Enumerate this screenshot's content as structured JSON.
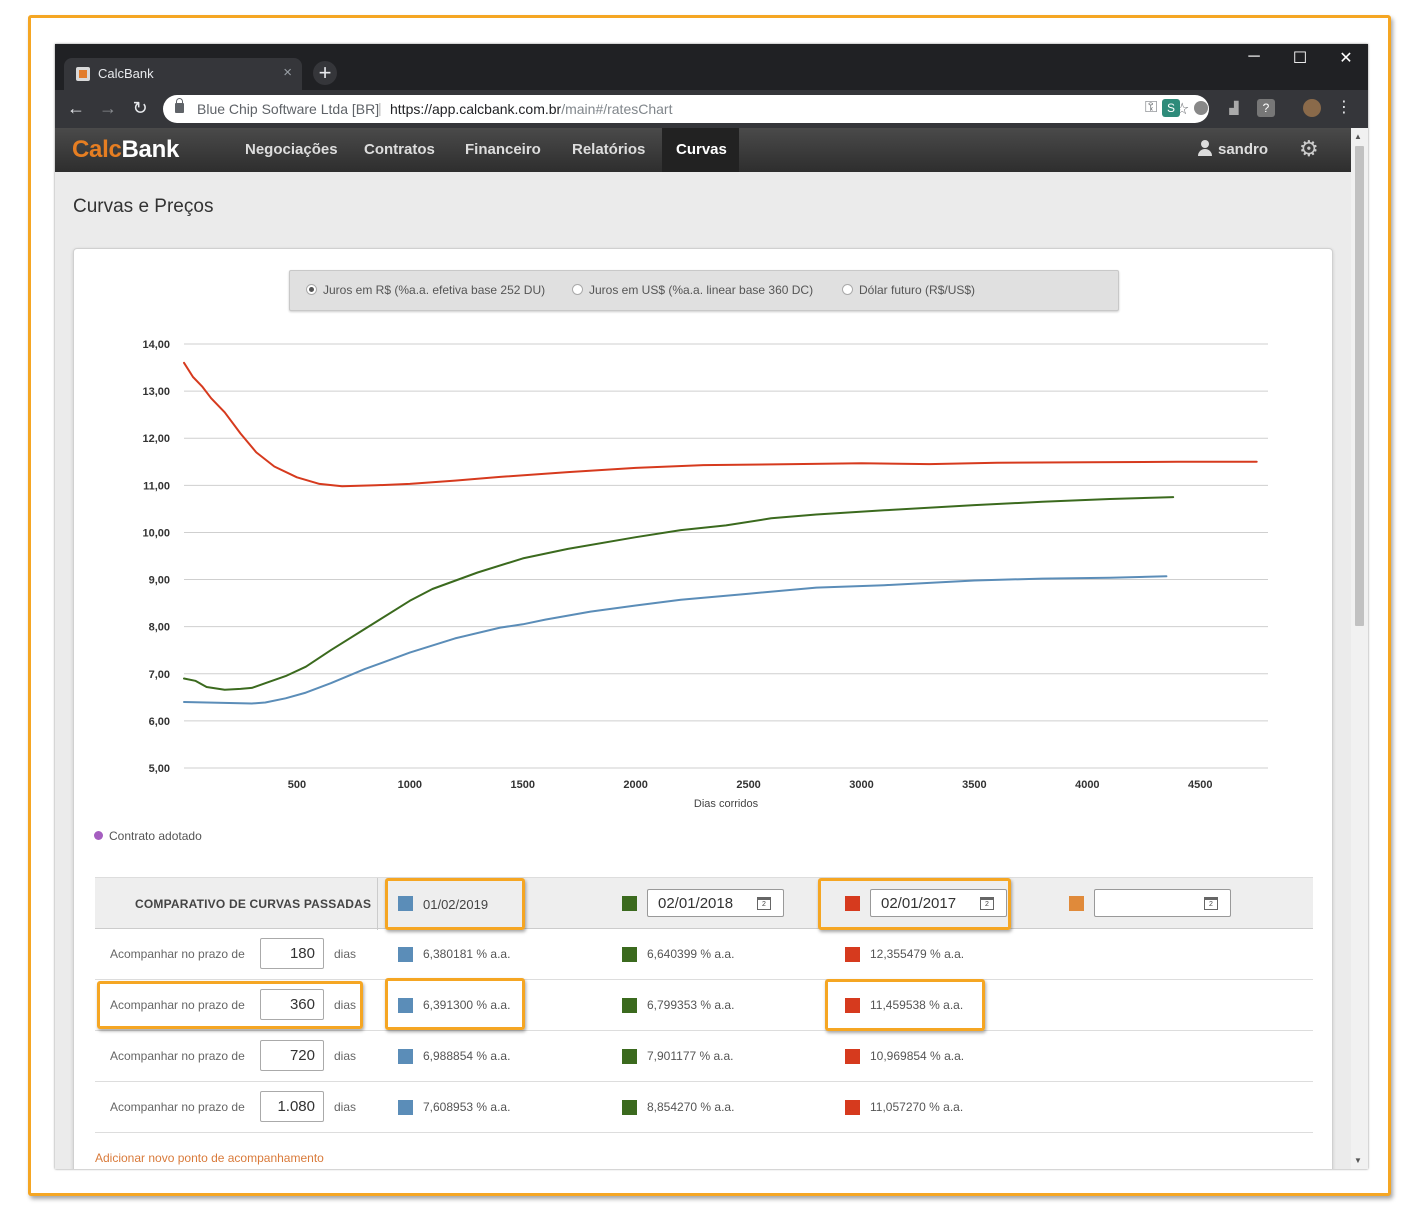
{
  "browser": {
    "tab_title": "CalcBank",
    "site_name": "Blue Chip Software Ltda [BR]",
    "url_base": "https://app.calcbank.com.br",
    "url_path": "/main#/ratesChart"
  },
  "app": {
    "logo_a": "Calc",
    "logo_b": "Bank",
    "nav": [
      "Negociações",
      "Contratos",
      "Financeiro",
      "Relatórios",
      "Curvas"
    ],
    "active_nav": "Curvas",
    "user": "sandro",
    "page_title": "Curvas e Preços"
  },
  "radio_options": [
    {
      "label": "Juros em R$ (%a.a. efetiva base 252 DU)",
      "selected": true
    },
    {
      "label": "Juros em US$ (%a.a. linear base 360 DC)",
      "selected": false
    },
    {
      "label": "Dólar futuro (R$/US$)",
      "selected": false
    }
  ],
  "legend": {
    "label": "Contrato adotado",
    "color": "#a55ec0"
  },
  "chart_data": {
    "type": "line",
    "xlabel": "Dias corridos",
    "ylabel": "",
    "xlim": [
      0,
      4800
    ],
    "ylim": [
      5,
      14
    ],
    "x_ticks": [
      500,
      1000,
      1500,
      2000,
      2500,
      3000,
      3500,
      4000,
      4500
    ],
    "y_ticks": [
      "5,00",
      "6,00",
      "7,00",
      "8,00",
      "9,00",
      "10,00",
      "11,00",
      "12,00",
      "13,00",
      "14,00"
    ],
    "grid": true,
    "series": [
      {
        "color": "#5b8db8",
        "points": [
          [
            0,
            6.4
          ],
          [
            100,
            6.39
          ],
          [
            200,
            6.38
          ],
          [
            300,
            6.37
          ],
          [
            360,
            6.39
          ],
          [
            450,
            6.48
          ],
          [
            540,
            6.6
          ],
          [
            650,
            6.8
          ],
          [
            800,
            7.1
          ],
          [
            1000,
            7.45
          ],
          [
            1200,
            7.75
          ],
          [
            1400,
            7.98
          ],
          [
            1500,
            8.05
          ],
          [
            1600,
            8.15
          ],
          [
            1800,
            8.32
          ],
          [
            2000,
            8.45
          ],
          [
            2200,
            8.57
          ],
          [
            2500,
            8.7
          ],
          [
            2800,
            8.83
          ],
          [
            3100,
            8.88
          ],
          [
            3500,
            8.98
          ],
          [
            3800,
            9.02
          ],
          [
            4100,
            9.04
          ],
          [
            4350,
            9.07
          ]
        ]
      },
      {
        "color": "#3b6a1e",
        "points": [
          [
            0,
            6.9
          ],
          [
            50,
            6.85
          ],
          [
            100,
            6.72
          ],
          [
            180,
            6.66
          ],
          [
            250,
            6.68
          ],
          [
            300,
            6.7
          ],
          [
            360,
            6.8
          ],
          [
            450,
            6.95
          ],
          [
            540,
            7.15
          ],
          [
            650,
            7.5
          ],
          [
            800,
            7.95
          ],
          [
            1000,
            8.55
          ],
          [
            1100,
            8.8
          ],
          [
            1300,
            9.15
          ],
          [
            1500,
            9.45
          ],
          [
            1700,
            9.65
          ],
          [
            2000,
            9.9
          ],
          [
            2200,
            10.05
          ],
          [
            2400,
            10.15
          ],
          [
            2600,
            10.3
          ],
          [
            2800,
            10.38
          ],
          [
            3100,
            10.47
          ],
          [
            3500,
            10.58
          ],
          [
            3800,
            10.65
          ],
          [
            4100,
            10.71
          ],
          [
            4380,
            10.75
          ]
        ]
      },
      {
        "color": "#d63a1e",
        "points": [
          [
            0,
            13.6
          ],
          [
            40,
            13.3
          ],
          [
            80,
            13.1
          ],
          [
            120,
            12.85
          ],
          [
            180,
            12.55
          ],
          [
            250,
            12.1
          ],
          [
            320,
            11.7
          ],
          [
            400,
            11.4
          ],
          [
            500,
            11.17
          ],
          [
            600,
            11.03
          ],
          [
            700,
            10.98
          ],
          [
            850,
            11.0
          ],
          [
            1000,
            11.03
          ],
          [
            1200,
            11.1
          ],
          [
            1400,
            11.18
          ],
          [
            1700,
            11.28
          ],
          [
            2000,
            11.37
          ],
          [
            2300,
            11.43
          ],
          [
            2700,
            11.45
          ],
          [
            3000,
            11.47
          ],
          [
            3300,
            11.45
          ],
          [
            3600,
            11.48
          ],
          [
            4000,
            11.49
          ],
          [
            4400,
            11.5
          ],
          [
            4750,
            11.5
          ]
        ]
      }
    ]
  },
  "comparison": {
    "title": "COMPARATIVO DE CURVAS PASSADAS",
    "dates": [
      {
        "value": "01/02/2019",
        "color": "#5b8db8",
        "editable": false
      },
      {
        "value": "02/01/2018",
        "color": "#3b6a1e",
        "editable": true
      },
      {
        "value": "02/01/2017",
        "color": "#d63a1e",
        "editable": true
      },
      {
        "value": "",
        "color": "#e08a3a",
        "editable": true
      }
    ],
    "row_label": "Acompanhar no prazo de",
    "days_label": "dias",
    "rows": [
      {
        "days": "180",
        "rates": [
          "6,380181 % a.a.",
          "6,640399 % a.a.",
          "12,355479 % a.a."
        ]
      },
      {
        "days": "360",
        "rates": [
          "6,391300 % a.a.",
          "6,799353 % a.a.",
          "11,459538 % a.a."
        ]
      },
      {
        "days": "720",
        "rates": [
          "6,988854 % a.a.",
          "7,901177 % a.a.",
          "10,969854 % a.a."
        ]
      },
      {
        "days": "1.080",
        "rates": [
          "7,608953 % a.a.",
          "8,854270 % a.a.",
          "11,057270 % a.a."
        ]
      }
    ],
    "add_link": "Adicionar novo ponto de acompanhamento"
  }
}
